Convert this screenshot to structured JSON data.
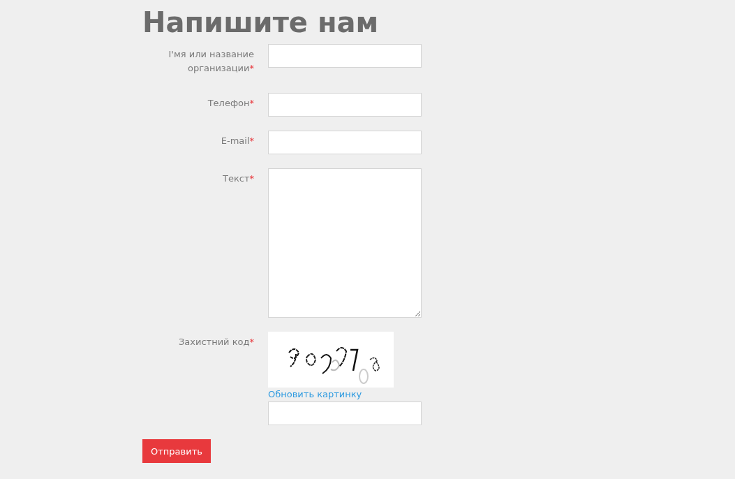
{
  "heading": "Напишите нам",
  "fields": [
    {
      "kind": "input",
      "label": "І'мя или название организации",
      "required_mark": "*"
    },
    {
      "kind": "input",
      "label": "Телефон",
      "required_mark": "*"
    },
    {
      "kind": "input",
      "label": "E-mail",
      "required_mark": "*"
    },
    {
      "kind": "textarea",
      "label": "Текст",
      "required_mark": "*"
    },
    {
      "kind": "captcha",
      "label": "Захистний код",
      "required_mark": "*",
      "refresh_link": "Обновить картинку"
    }
  ],
  "submit": {
    "label": "Отправить"
  }
}
